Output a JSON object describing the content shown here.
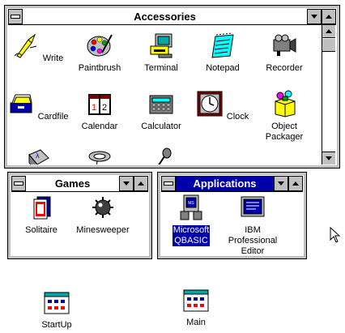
{
  "accessories": {
    "title": "Accessories",
    "items": [
      {
        "label": "Write"
      },
      {
        "label": "Paintbrush"
      },
      {
        "label": "Terminal"
      },
      {
        "label": "Notepad"
      },
      {
        "label": "Recorder"
      },
      {
        "label": "Cardfile"
      },
      {
        "label": "Calendar"
      },
      {
        "label": "Calculator"
      },
      {
        "label": "Clock"
      },
      {
        "label": "Object\nPackager"
      }
    ]
  },
  "games": {
    "title": "Games",
    "items": [
      {
        "label": "Solitaire"
      },
      {
        "label": "Minesweeper"
      }
    ]
  },
  "applications": {
    "title": "Applications",
    "items": [
      {
        "label": "Microsoft\nQBASIC",
        "selected": true
      },
      {
        "label": "IBM\nProfessional\nEditor"
      }
    ]
  },
  "minimized": [
    {
      "label": "StartUp"
    },
    {
      "label": "Main"
    }
  ],
  "colors": {
    "active_title": "#0000a8",
    "frame": "#c0c0c0"
  }
}
